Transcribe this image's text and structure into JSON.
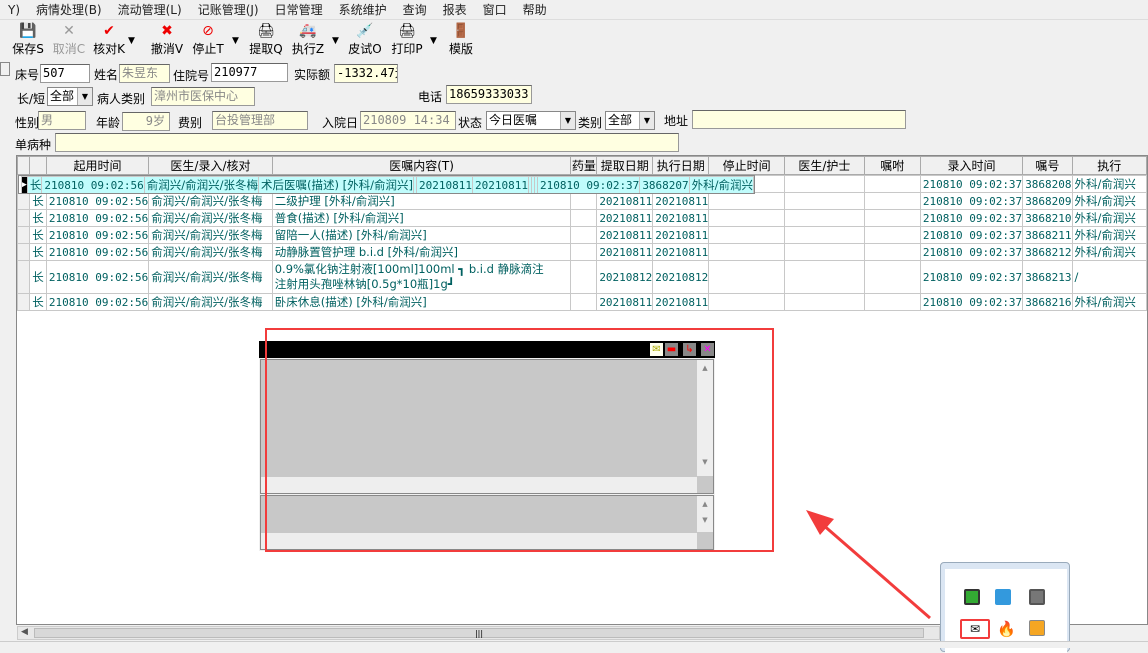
{
  "menu": [
    "Y)",
    "病情处理(B)",
    "流动管理(L)",
    "记账管理(J)",
    "日常管理",
    "系统维护",
    "查询",
    "报表",
    "窗口",
    "帮助"
  ],
  "toolbar": {
    "save": "保存S",
    "cancel": "取消C",
    "check": "核对K",
    "undo": "撤消V",
    "stop": "停止T",
    "fetch": "提取Q",
    "execute": "执行Z",
    "skintest": "皮试O",
    "print": "打印P",
    "template": "模版"
  },
  "form": {
    "bed_label": "床号",
    "bed": "507",
    "name_label": "姓名",
    "name": "朱昱东",
    "inpatient_label": "住院号",
    "inpatient": "210977",
    "actual_label": "实际额",
    "actual": "-1332.47元",
    "term_label": "长/短",
    "term": "全部",
    "ptype_label": "病人类别",
    "ptype": "漳州市医保中心",
    "phone_label": "电话",
    "phone": "18659333033",
    "sex_label": "性别",
    "sex": "男",
    "age_label": "年龄",
    "age": "9岁",
    "fee_label": "费别",
    "fee": "台投管理部",
    "admit_label": "入院日",
    "admit": "210809 14:34",
    "status_label": "状态",
    "status": "今日医嘱",
    "category_label": "类别",
    "category": "全部",
    "address_label": "地址",
    "address": "",
    "disease_label": "单病种",
    "disease": ""
  },
  "grid": {
    "headers": [
      "",
      "",
      "起用时间",
      "医生/录入/核对",
      "医嘱内容(T)",
      "药量",
      "提取日期",
      "执行日期",
      "停止时间",
      "医生/护士",
      "嘱咐",
      "录入时间",
      "嘱号",
      "执行"
    ],
    "rows": [
      {
        "type": "长",
        "start": "210810 09:02:56",
        "doctor": "俞润兴/俞润兴/张冬梅",
        "content": "术后医嘱(描述)   [外科/俞润兴]",
        "fetch": "20210811",
        "exec": "20210811",
        "entry": "210810 09:02:37",
        "no": "3868207",
        "executor": "外科/俞润兴"
      },
      {
        "type": "长",
        "start": "210810 09:02:56",
        "doctor": "俞润兴/俞润兴/张冬梅",
        "content": "按外科常规护理(描述)   [外科/俞润兴]",
        "fetch": "20210811",
        "exec": "20210811",
        "entry": "210810 09:02:37",
        "no": "3868208",
        "executor": "外科/俞润兴"
      },
      {
        "type": "长",
        "start": "210810 09:02:56",
        "doctor": "俞润兴/俞润兴/张冬梅",
        "content": "二级护理   [外科/俞润兴]",
        "fetch": "20210811",
        "exec": "20210811",
        "entry": "210810 09:02:37",
        "no": "3868209",
        "executor": "外科/俞润兴"
      },
      {
        "type": "长",
        "start": "210810 09:02:56",
        "doctor": "俞润兴/俞润兴/张冬梅",
        "content": "普食(描述)   [外科/俞润兴]",
        "fetch": "20210811",
        "exec": "20210811",
        "entry": "210810 09:02:37",
        "no": "3868210",
        "executor": "外科/俞润兴"
      },
      {
        "type": "长",
        "start": "210810 09:02:56",
        "doctor": "俞润兴/俞润兴/张冬梅",
        "content": "留陪一人(描述)   [外科/俞润兴]",
        "fetch": "20210811",
        "exec": "20210811",
        "entry": "210810 09:02:37",
        "no": "3868211",
        "executor": "外科/俞润兴"
      },
      {
        "type": "长",
        "start": "210810 09:02:56",
        "doctor": "俞润兴/俞润兴/张冬梅",
        "content": "动静脉置管护理 b.i.d  [外科/俞润兴]",
        "fetch": "20210811",
        "exec": "20210811",
        "entry": "210810 09:02:37",
        "no": "3868212",
        "executor": "外科/俞润兴"
      },
      {
        "type": "长",
        "start": "210810 09:02:56",
        "doctor": "俞润兴/俞润兴/张冬梅",
        "content": "0.9%氯化钠注射液[100ml]100ml ┓ b.i.d 静脉滴注",
        "content2": "注射用头孢唑林钠[0.5g*10瓶]1g┛",
        "fetch": "20210812",
        "exec": "20210812",
        "entry": "210810 09:02:37",
        "no": "3868213",
        "executor": "/"
      },
      {
        "type": "长",
        "start": "210810 09:02:56",
        "doctor": "俞润兴/俞润兴/张冬梅",
        "content": "卧床休息(描述)   [外科/俞润兴]",
        "fetch": "20210811",
        "exec": "20210811",
        "entry": "210810 09:02:37",
        "no": "3868216",
        "executor": "外科/俞润兴"
      }
    ]
  },
  "colors": {
    "selected_row": "#c0fcfc",
    "text": "#006060",
    "annotation": "#f23c3c"
  }
}
